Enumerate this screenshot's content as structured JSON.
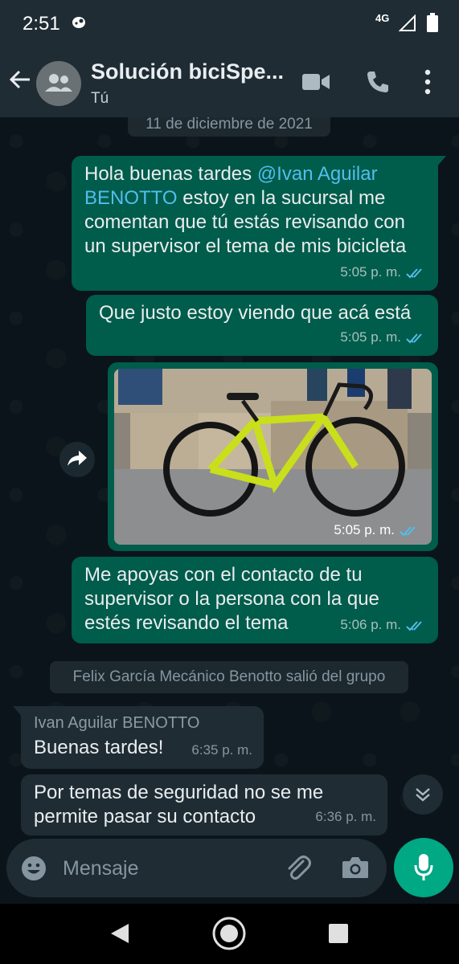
{
  "status_bar": {
    "time": "2:51",
    "network": "4G"
  },
  "header": {
    "title": "Solución biciSpe...",
    "subtitle": "Tú"
  },
  "chat": {
    "date_separator": "11 de diciembre de 2021",
    "messages": [
      {
        "text_before": "Hola buenas tardes ",
        "mention": "@Ivan Aguilar BENOTTO",
        "text_after": " estoy en la sucursal me comentan que tú estás revisando con un supervisor el tema de mis bicicleta",
        "time": "5:05 p. m."
      },
      {
        "text": "Que justo estoy viendo que acá está",
        "time": "5:05 p. m."
      },
      {
        "image_alt": "Bicicleta amarilla en la tienda",
        "time": "5:05 p. m."
      },
      {
        "text": "Me apoyas con el contacto de tu supervisor o la persona con la que estés revisando el tema",
        "time": "5:06 p. m."
      }
    ],
    "system_message": "Felix García Mecánico Benotto salió del grupo",
    "incoming": [
      {
        "sender": "Ivan Aguilar BENOTTO",
        "text": "Buenas tardes!",
        "time": "6:35 p. m."
      },
      {
        "text": "Por temas de seguridad no se me permite pasar su contacto",
        "time": "6:36 p. m."
      }
    ]
  },
  "input": {
    "placeholder": "Mensaje"
  },
  "colors": {
    "outgoing": "#005c4b",
    "incoming": "#1f2c34",
    "accent": "#00a884",
    "read_ticks": "#53bdeb"
  },
  "icons": [
    "back-arrow-icon",
    "group-avatar-icon",
    "video-call-icon",
    "voice-call-icon",
    "more-options-icon",
    "forward-icon",
    "double-check-icon",
    "scroll-down-icon",
    "emoji-icon",
    "attach-icon",
    "camera-icon",
    "mic-icon"
  ]
}
